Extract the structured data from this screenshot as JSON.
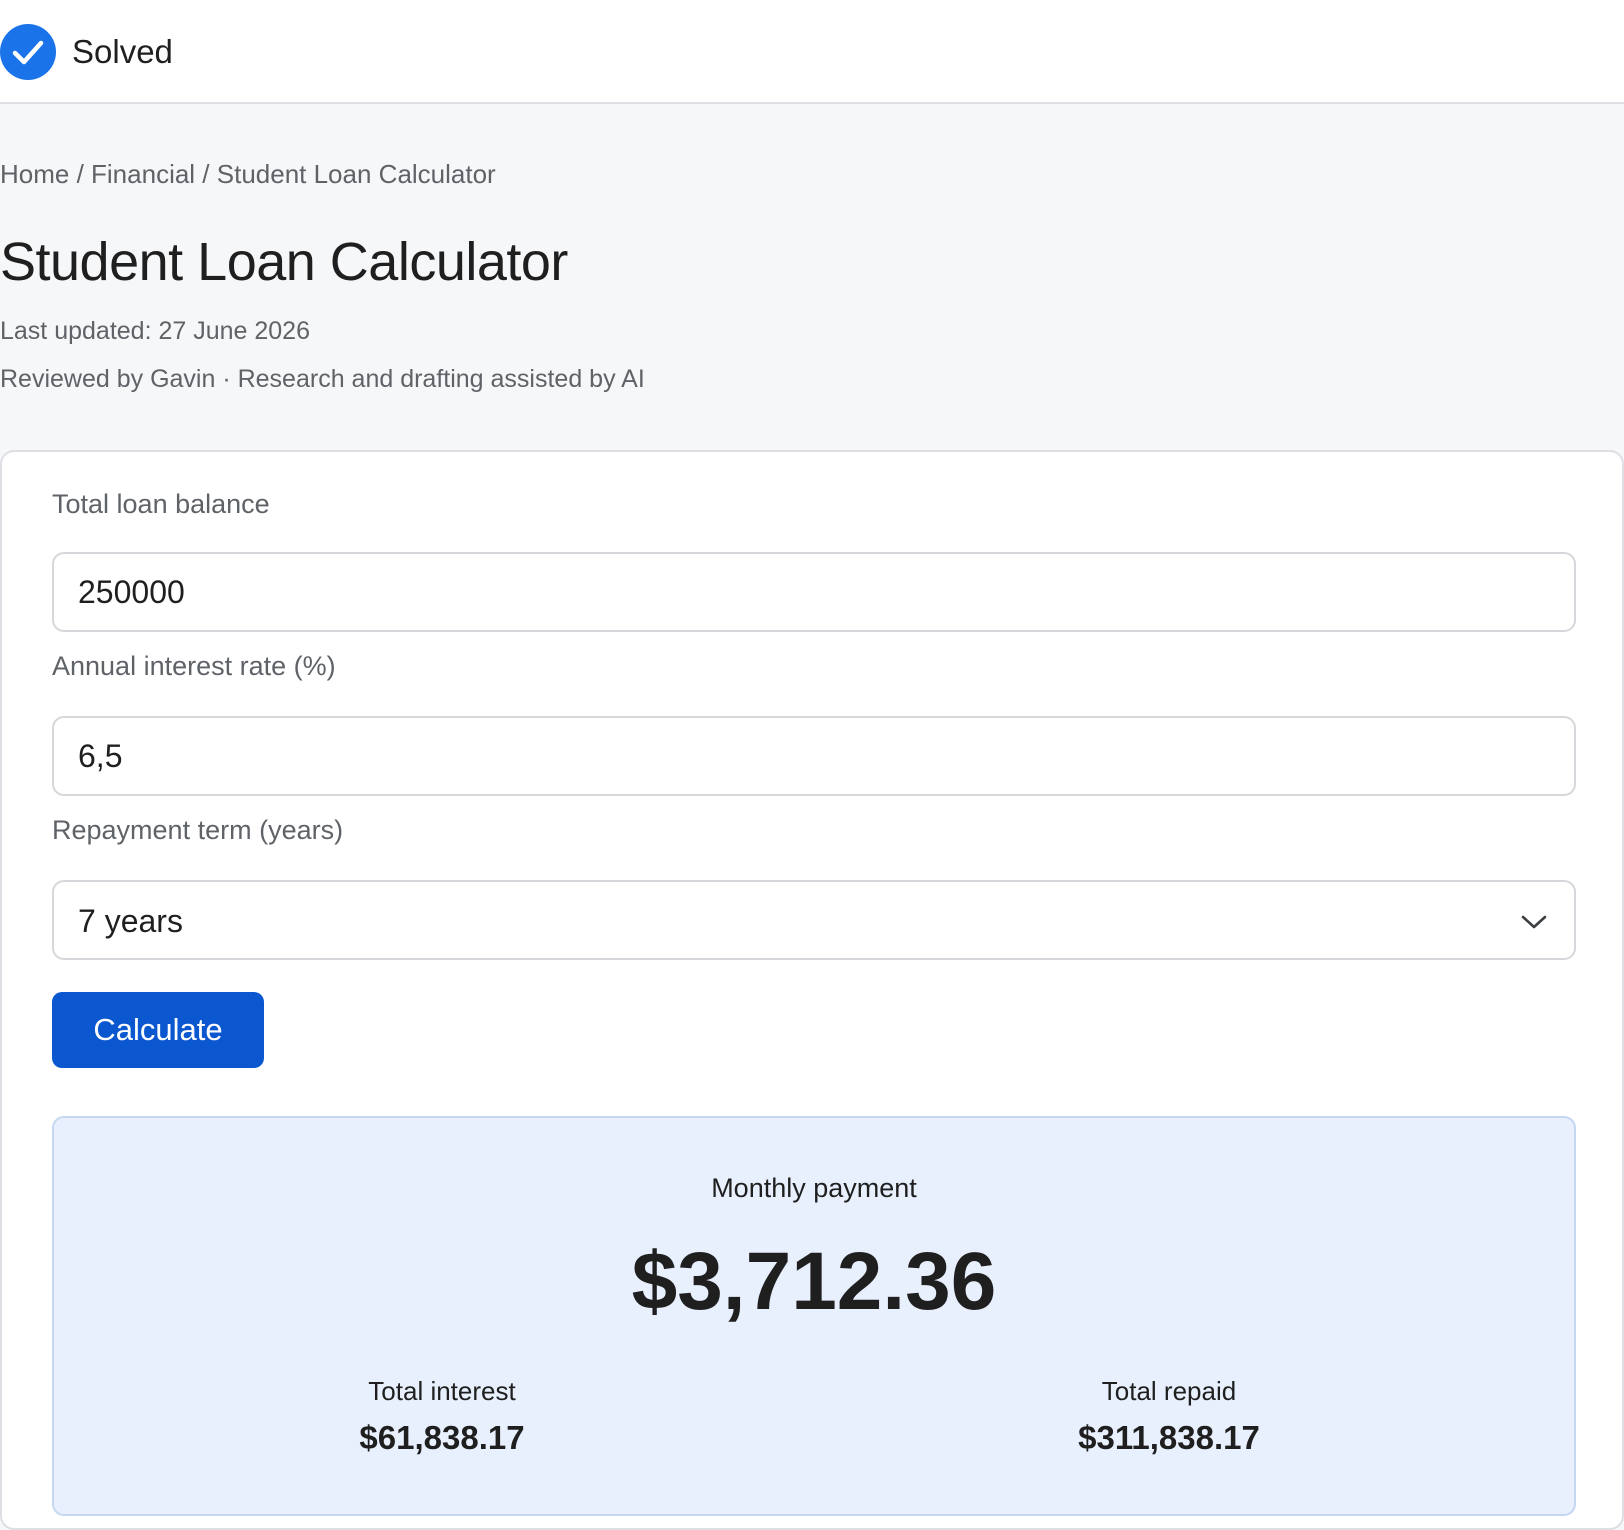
{
  "header": {
    "status_label": "Solved"
  },
  "breadcrumb": "Home / Financial / Student Loan Calculator",
  "page": {
    "title": "Student Loan Calculator",
    "last_updated": "Last updated: 27 June 2026",
    "review_note": "Reviewed by Gavin · Research and drafting assisted by AI"
  },
  "form": {
    "loan_balance": {
      "label": "Total loan balance",
      "value": "250000"
    },
    "interest_rate": {
      "label": "Annual interest rate (%)",
      "value": "6,5"
    },
    "term": {
      "label": "Repayment term (years)",
      "selected": "7 years"
    },
    "calculate_label": "Calculate"
  },
  "result": {
    "monthly_label": "Monthly payment",
    "monthly_value": "$3,712.36",
    "interest_label": "Total interest",
    "interest_value": "$61,838.17",
    "repaid_label": "Total repaid",
    "repaid_value": "$311,838.17"
  },
  "colors": {
    "accent": "#0b57d0",
    "solved_badge": "#1a73e8",
    "result_background": "#e8f0fe",
    "page_background": "#f6f7f9"
  },
  "icons": {
    "status": "check-circle-icon",
    "select": "chevron-down-icon"
  }
}
